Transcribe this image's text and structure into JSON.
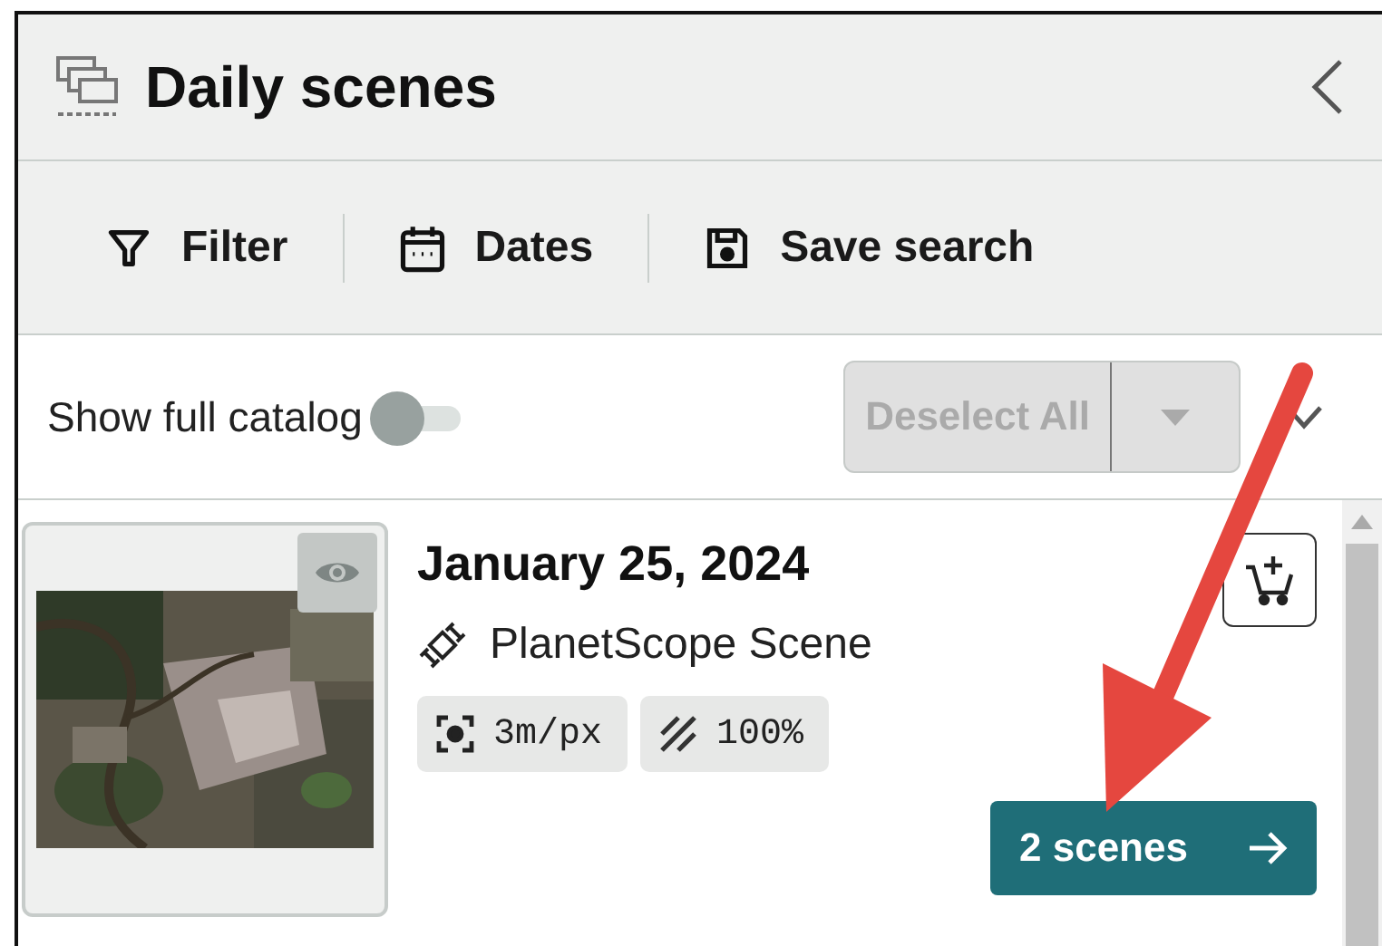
{
  "panel": {
    "title": "Daily scenes"
  },
  "toolbar": [
    {
      "kind": "filter",
      "label": "Filter"
    },
    {
      "kind": "dates",
      "label": "Dates"
    },
    {
      "kind": "save",
      "label": "Save search"
    }
  ],
  "catalog_toggle": {
    "label": "Show full catalog",
    "on": false
  },
  "deselect": {
    "label": "Deselect All",
    "disabled": true
  },
  "scenes": [
    {
      "date": "January 25, 2024",
      "source": "PlanetScope Scene",
      "chips": [
        {
          "kind": "resolution",
          "label": "3m/px"
        },
        {
          "kind": "coverage",
          "label": "100%"
        }
      ],
      "scenes_button": "2 scenes"
    }
  ]
}
